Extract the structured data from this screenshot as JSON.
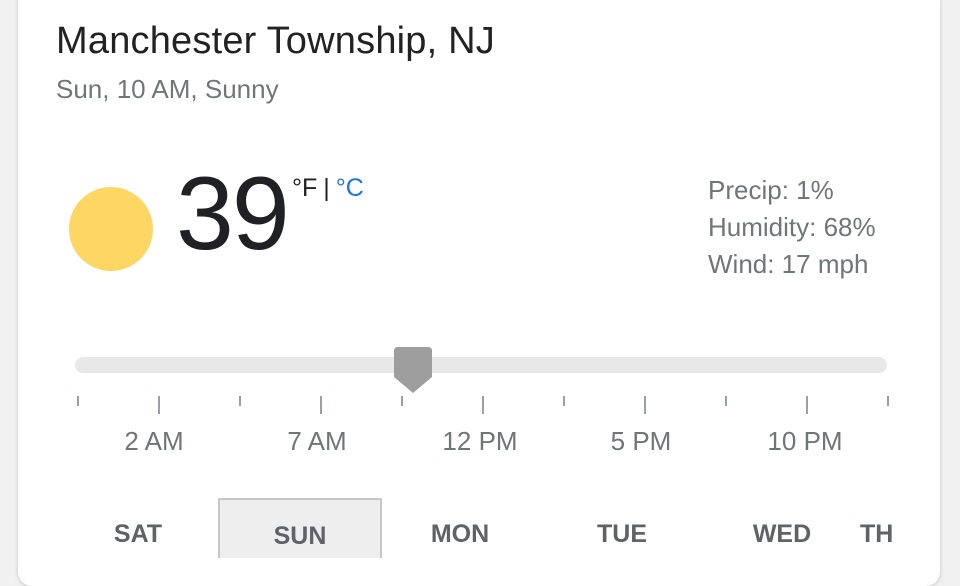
{
  "location": "Manchester Township, NJ",
  "subtitle": "Sun, 10 AM, Sunny",
  "current": {
    "icon": "sun-icon",
    "temperature": "39",
    "unit_f": "°F",
    "unit_separator": "|",
    "unit_c": "°C"
  },
  "details": {
    "precip": "Precip: 1%",
    "humidity": "Humidity: 68%",
    "wind": "Wind: 17 mph"
  },
  "timeline": {
    "labels": [
      "2 AM",
      "7 AM",
      "12 PM",
      "5 PM",
      "10 PM"
    ],
    "selected_hour": "10 AM"
  },
  "days": [
    "SAT",
    "SUN",
    "MON",
    "TUE",
    "WED",
    "TH"
  ],
  "selected_day": "SUN",
  "colors": {
    "sun": "#fdd663",
    "link": "#1a73e8",
    "muted": "#70757a",
    "thumb": "#9e9e9e"
  }
}
